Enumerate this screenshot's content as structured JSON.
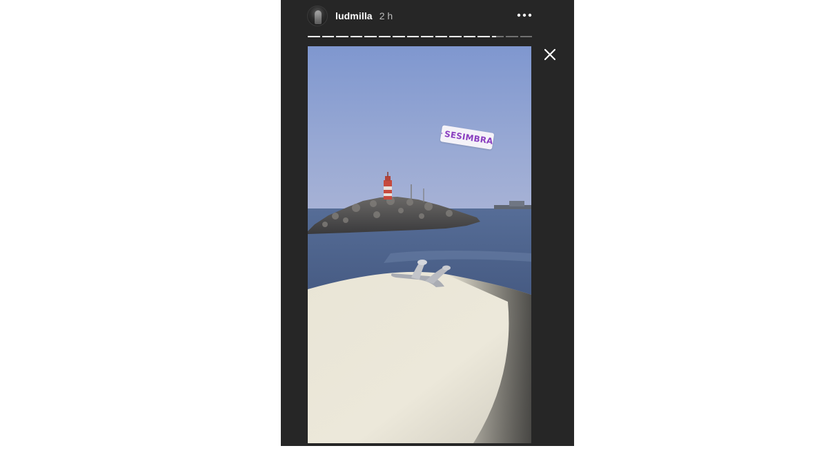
{
  "story": {
    "username": "ludmilla",
    "timestamp": "2 h",
    "segments_total": 16,
    "active_segment": 14,
    "active_segment_progress": 0.35,
    "location_sticker": "SESIMBRA"
  },
  "icons": {
    "more": "more-horizontal-icon",
    "close": "close-icon",
    "location_pin": "location-pin-icon"
  },
  "colors": {
    "panel_background": "#262626",
    "page_background": "#ffffff",
    "sticker_text": "#8a3fc0",
    "progress_active": "#ffffff"
  }
}
